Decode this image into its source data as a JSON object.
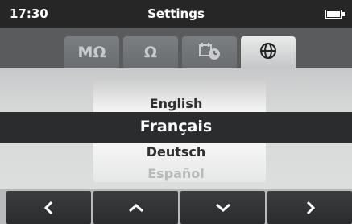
{
  "status": {
    "time": "17:30",
    "title": "Settings"
  },
  "tabs": [
    {
      "label": "MΩ",
      "active": false
    },
    {
      "label": "Ω",
      "active": false
    },
    {
      "label": "clock-settings-icon",
      "active": false
    },
    {
      "label": "globe-icon",
      "active": true
    }
  ],
  "languages": {
    "above": "English",
    "selected": "Français",
    "below": "Deutsch",
    "next": "Español"
  },
  "nav": {
    "buttons": [
      "chevron-left-icon",
      "chevron-up-icon",
      "chevron-down-icon",
      "chevron-right-icon"
    ]
  }
}
